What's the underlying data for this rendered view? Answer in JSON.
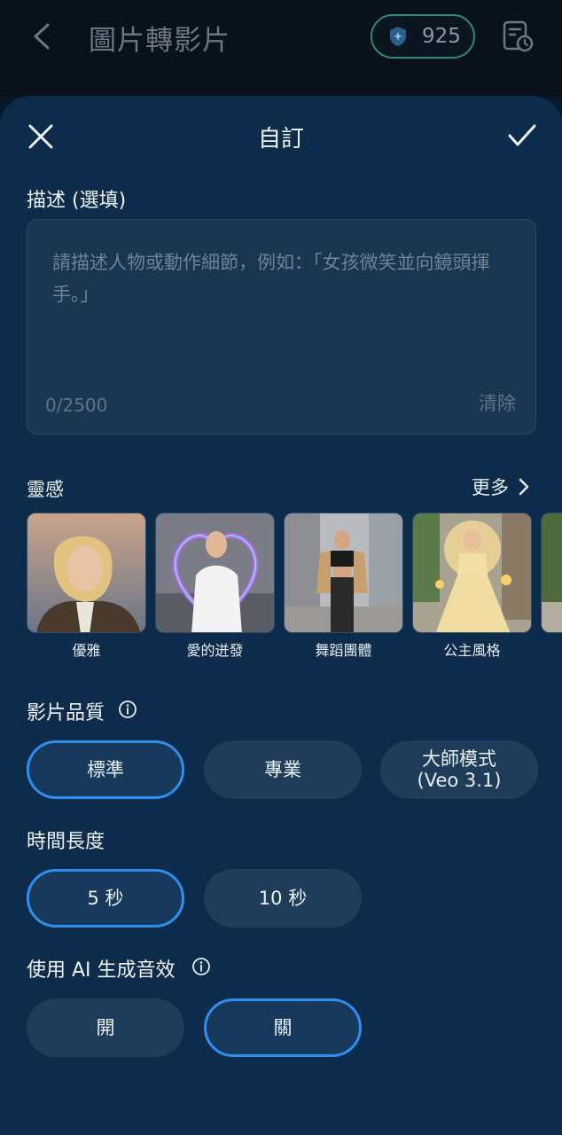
{
  "header": {
    "title": "圖片轉影片",
    "credits": "925"
  },
  "sheet": {
    "title": "自訂",
    "description_label": "描述 (選填)",
    "description_placeholder": "請描述人物或動作細節，例如：「女孩微笑並向鏡頭揮手。」",
    "counter": "0/2500",
    "clear_label": "清除",
    "inspiration_label": "靈感",
    "more_label": "更多",
    "inspirations": [
      {
        "label": "優雅"
      },
      {
        "label": "愛的迸發"
      },
      {
        "label": "舞蹈團體"
      },
      {
        "label": "公主風格"
      }
    ],
    "quality_label": "影片品質",
    "quality_options": [
      "標準",
      "專業",
      "大師模式\n(Veo 3.1)"
    ],
    "quality_selected": "標準",
    "duration_label": "時間長度",
    "duration_options": [
      "5 秒",
      "10 秒"
    ],
    "duration_selected": "5 秒",
    "audio_label": "使用 AI 生成音效",
    "audio_options": [
      "開",
      "關"
    ],
    "audio_selected": "關"
  },
  "colors": {
    "sheet_bg": "#0d2c4b",
    "accent": "#2f8ff0",
    "credit_border": "#2f8a76"
  }
}
